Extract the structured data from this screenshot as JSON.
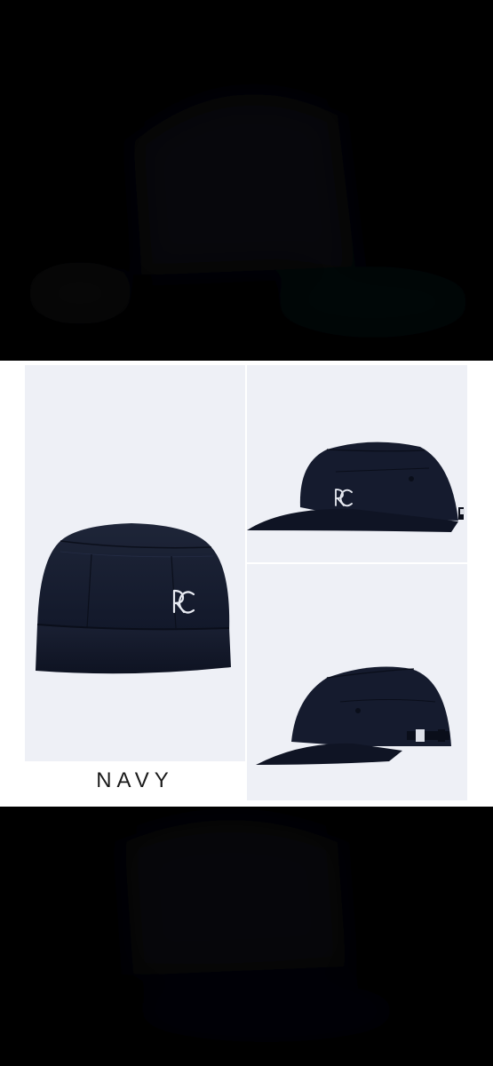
{
  "product": {
    "color_label": "NAVY",
    "logo_monogram": "RC"
  },
  "colors": {
    "cap_navy": "#141a2b",
    "cap_navy_light": "#1f2740",
    "panel_bg": "#eef0f6",
    "page_bg": "#000000"
  }
}
